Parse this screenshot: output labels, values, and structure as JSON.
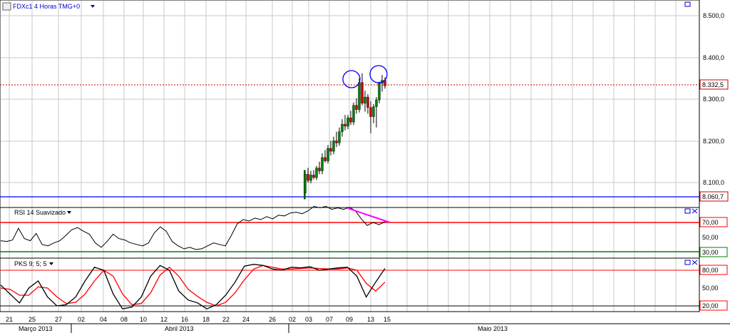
{
  "main_panel": {
    "title": "FDXc1 4 Horas TMG+0",
    "price_ticks": [
      "8.500,0",
      "8.400,0",
      "8.300,0",
      "8.200,0",
      "8.100,0"
    ],
    "last_price_label": "8.332,5",
    "support_label": "8.060,7"
  },
  "rsi_panel": {
    "title": "RSI 14 Suavizado",
    "upper_label": "70,00",
    "mid_label": "50,00",
    "lower_label": "30,00"
  },
  "pks_panel": {
    "title": "PKS 9; 5; 5",
    "upper_label": "80,00",
    "mid_label": "50,00",
    "lower_label": "20,00"
  },
  "time_axis": {
    "day_labels": [
      "21",
      "25",
      "27",
      "02",
      "04",
      "08",
      "10",
      "12",
      "16",
      "18",
      "22",
      "24",
      "26",
      "02",
      "03",
      "07",
      "09",
      "13",
      "15"
    ],
    "month_labels": [
      "Março 2013",
      "Abril 2013",
      "Maio 2013"
    ]
  },
  "colors": {
    "price_reference_line": "#cc0000",
    "support_line": "#0000ff",
    "divergence_line": "#ff00ff",
    "highlight_circles": "#0000ff",
    "rsi_upper_line": "#ff0000",
    "rsi_lower_line": "#008000",
    "pks_k_line": "#000000",
    "pks_d_line": "#ff0000"
  },
  "chart_data": [
    {
      "type": "candlestick",
      "title": "FDXc1 4 Horas TMG+0",
      "y_ticks": [
        8500,
        8400,
        8300,
        8200,
        8100
      ],
      "ylim": [
        8000,
        8560
      ],
      "reference_lines": [
        {
          "value": 8332.5,
          "style": "dotted"
        },
        {
          "value": 8060.7,
          "style": "solid"
        }
      ],
      "series": [
        {
          "values": [
            {
              "o": 8075,
              "h": 8130,
              "l": 8060,
              "c": 8120
            },
            {
              "o": 8120,
              "h": 8135,
              "l": 8100,
              "c": 8105
            },
            {
              "o": 8105,
              "h": 8128,
              "l": 8098,
              "c": 8118
            },
            {
              "o": 8118,
              "h": 8130,
              "l": 8108,
              "c": 8112
            },
            {
              "o": 8112,
              "h": 8140,
              "l": 8106,
              "c": 8135
            },
            {
              "o": 8135,
              "h": 8150,
              "l": 8120,
              "c": 8128
            },
            {
              "o": 8128,
              "h": 8170,
              "l": 8120,
              "c": 8160
            },
            {
              "o": 8160,
              "h": 8178,
              "l": 8148,
              "c": 8152
            },
            {
              "o": 8152,
              "h": 8190,
              "l": 8146,
              "c": 8182
            },
            {
              "o": 8182,
              "h": 8200,
              "l": 8165,
              "c": 8175
            },
            {
              "o": 8175,
              "h": 8210,
              "l": 8168,
              "c": 8200
            },
            {
              "o": 8200,
              "h": 8222,
              "l": 8185,
              "c": 8195
            },
            {
              "o": 8195,
              "h": 8232,
              "l": 8188,
              "c": 8222
            },
            {
              "o": 8222,
              "h": 8252,
              "l": 8210,
              "c": 8240
            },
            {
              "o": 8240,
              "h": 8262,
              "l": 8225,
              "c": 8235
            },
            {
              "o": 8235,
              "h": 8262,
              "l": 8228,
              "c": 8255
            },
            {
              "o": 8255,
              "h": 8272,
              "l": 8238,
              "c": 8245
            },
            {
              "o": 8245,
              "h": 8292,
              "l": 8238,
              "c": 8285
            },
            {
              "o": 8285,
              "h": 8302,
              "l": 8265,
              "c": 8275
            },
            {
              "o": 8275,
              "h": 8350,
              "l": 8268,
              "c": 8340
            },
            {
              "o": 8340,
              "h": 8362,
              "l": 8285,
              "c": 8290
            },
            {
              "o": 8290,
              "h": 8320,
              "l": 8270,
              "c": 8305
            },
            {
              "o": 8305,
              "h": 8312,
              "l": 8265,
              "c": 8280
            },
            {
              "o": 8280,
              "h": 8295,
              "l": 8218,
              "c": 8258
            },
            {
              "o": 8258,
              "h": 8288,
              "l": 8242,
              "c": 8282
            },
            {
              "o": 8282,
              "h": 8305,
              "l": 8232,
              "c": 8298
            },
            {
              "o": 8298,
              "h": 8342,
              "l": 8290,
              "c": 8338
            },
            {
              "o": 8338,
              "h": 8358,
              "l": 8318,
              "c": 8345
            },
            {
              "o": 8345,
              "h": 8352,
              "l": 8325,
              "c": 8332
            }
          ]
        }
      ]
    },
    {
      "type": "line",
      "title": "RSI 14 Suavizado",
      "ylim": [
        20,
        90
      ],
      "y_ticks": [
        70,
        50,
        30
      ],
      "reference_lines": [
        {
          "value": 70
        },
        {
          "value": 30
        }
      ],
      "series": [
        {
          "values": [
            45,
            44,
            46,
            62,
            48,
            45,
            55,
            40,
            38,
            42,
            45,
            52,
            60,
            63,
            58,
            54,
            42,
            36,
            44,
            54,
            48,
            46,
            42,
            40,
            38,
            42,
            56,
            64,
            58,
            44,
            38,
            34,
            36,
            33,
            34,
            38,
            42,
            40,
            38,
            52,
            68,
            74,
            72,
            76,
            74,
            78,
            75,
            80,
            79,
            83,
            84,
            82,
            86,
            92,
            90,
            92,
            88,
            90,
            88,
            91,
            86,
            75,
            66,
            70,
            67,
            71
          ]
        }
      ],
      "annotation": "divergence line"
    },
    {
      "type": "line",
      "title": "PKS 9; 5; 5",
      "ylim": [
        8,
        102
      ],
      "y_ticks": [
        80,
        50,
        20
      ],
      "reference_lines": [
        {
          "value": 80
        },
        {
          "value": 20
        }
      ],
      "series": [
        {
          "values": [
            55,
            40,
            25,
            50,
            62,
            35,
            20,
            22,
            35,
            62,
            85,
            80,
            40,
            15,
            18,
            35,
            70,
            88,
            80,
            45,
            30,
            25,
            15,
            22,
            38,
            60,
            87,
            90,
            88,
            82,
            80,
            85,
            84,
            86,
            80,
            82,
            84,
            85,
            70,
            35,
            60,
            83
          ]
        },
        {
          "values": [
            50,
            48,
            38,
            38,
            52,
            50,
            35,
            24,
            26,
            40,
            62,
            80,
            70,
            40,
            22,
            24,
            42,
            72,
            85,
            70,
            48,
            36,
            26,
            20,
            26,
            42,
            64,
            82,
            88,
            85,
            82,
            82,
            83,
            84,
            83,
            82,
            82,
            84,
            80,
            58,
            45,
            60
          ]
        }
      ]
    }
  ]
}
